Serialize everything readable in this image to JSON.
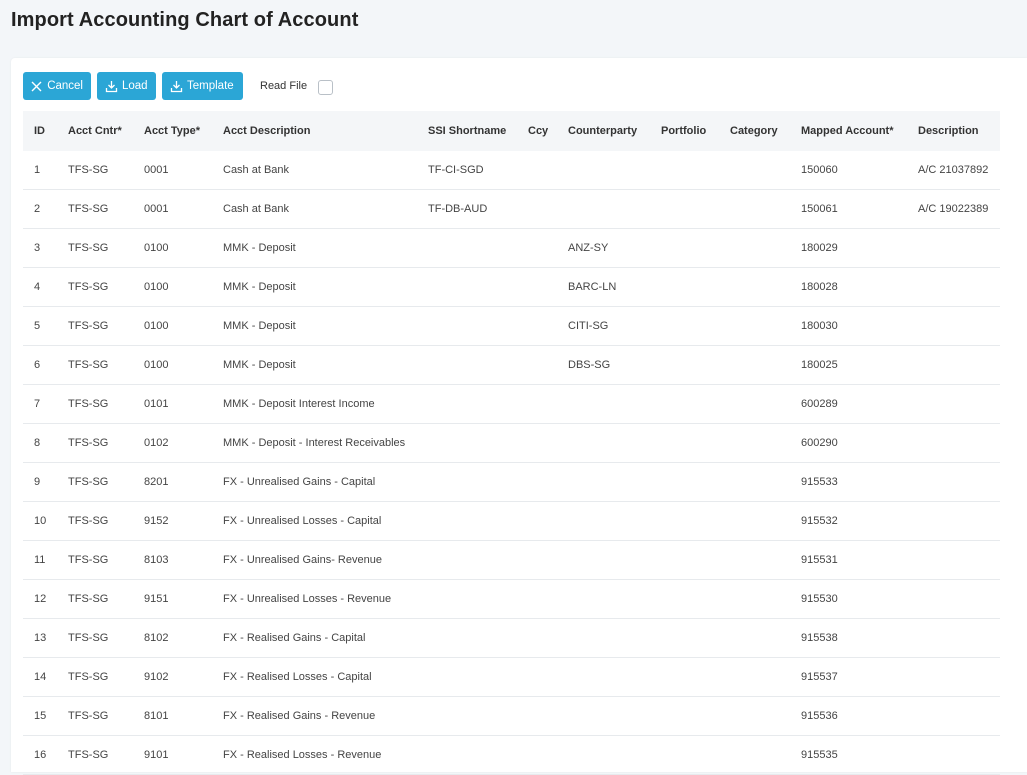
{
  "page": {
    "title": "Import Accounting Chart of Account"
  },
  "toolbar": {
    "cancel_label": "Cancel",
    "load_label": "Load",
    "template_label": "Template",
    "read_file_label": "Read File",
    "read_file_checked": false
  },
  "colors": {
    "button": "#2ba6d6",
    "header_bg": "#f4f6f8",
    "page_bg": "#f3f6f9"
  },
  "table": {
    "columns": [
      "ID",
      "Acct Cntr*",
      "Acct Type*",
      "Acct Description",
      "SSI Shortname",
      "Ccy",
      "Counterparty",
      "Portfolio",
      "Category",
      "Mapped Account*",
      "Description"
    ],
    "rows": [
      [
        "1",
        "TFS-SG",
        "0001",
        "Cash at Bank",
        "TF-CI-SGD",
        "",
        "",
        "",
        "",
        "150060",
        "A/C 21037892"
      ],
      [
        "2",
        "TFS-SG",
        "0001",
        "Cash at Bank",
        "TF-DB-AUD",
        "",
        "",
        "",
        "",
        "150061",
        "A/C 19022389"
      ],
      [
        "3",
        "TFS-SG",
        "0100",
        "MMK - Deposit",
        "",
        "",
        "ANZ-SY",
        "",
        "",
        "180029",
        ""
      ],
      [
        "4",
        "TFS-SG",
        "0100",
        "MMK - Deposit",
        "",
        "",
        "BARC-LN",
        "",
        "",
        "180028",
        ""
      ],
      [
        "5",
        "TFS-SG",
        "0100",
        "MMK - Deposit",
        "",
        "",
        "CITI-SG",
        "",
        "",
        "180030",
        ""
      ],
      [
        "6",
        "TFS-SG",
        "0100",
        "MMK - Deposit",
        "",
        "",
        "DBS-SG",
        "",
        "",
        "180025",
        ""
      ],
      [
        "7",
        "TFS-SG",
        "0101",
        "MMK - Deposit Interest Income",
        "",
        "",
        "",
        "",
        "",
        "600289",
        ""
      ],
      [
        "8",
        "TFS-SG",
        "0102",
        "MMK - Deposit - Interest Receivables",
        "",
        "",
        "",
        "",
        "",
        "600290",
        ""
      ],
      [
        "9",
        "TFS-SG",
        "8201",
        "FX - Unrealised Gains - Capital",
        "",
        "",
        "",
        "",
        "",
        "915533",
        ""
      ],
      [
        "10",
        "TFS-SG",
        "9152",
        "FX - Unrealised Losses - Capital",
        "",
        "",
        "",
        "",
        "",
        "915532",
        ""
      ],
      [
        "11",
        "TFS-SG",
        "8103",
        "FX - Unrealised Gains- Revenue",
        "",
        "",
        "",
        "",
        "",
        "915531",
        ""
      ],
      [
        "12",
        "TFS-SG",
        "9151",
        "FX - Unrealised Losses - Revenue",
        "",
        "",
        "",
        "",
        "",
        "915530",
        ""
      ],
      [
        "13",
        "TFS-SG",
        "8102",
        "FX - Realised Gains - Capital",
        "",
        "",
        "",
        "",
        "",
        "915538",
        ""
      ],
      [
        "14",
        "TFS-SG",
        "9102",
        "FX - Realised Losses - Capital",
        "",
        "",
        "",
        "",
        "",
        "915537",
        ""
      ],
      [
        "15",
        "TFS-SG",
        "8101",
        "FX - Realised Gains - Revenue",
        "",
        "",
        "",
        "",
        "",
        "915536",
        ""
      ],
      [
        "16",
        "TFS-SG",
        "9101",
        "FX - Realised Losses - Revenue",
        "",
        "",
        "",
        "",
        "",
        "915535",
        ""
      ]
    ]
  }
}
